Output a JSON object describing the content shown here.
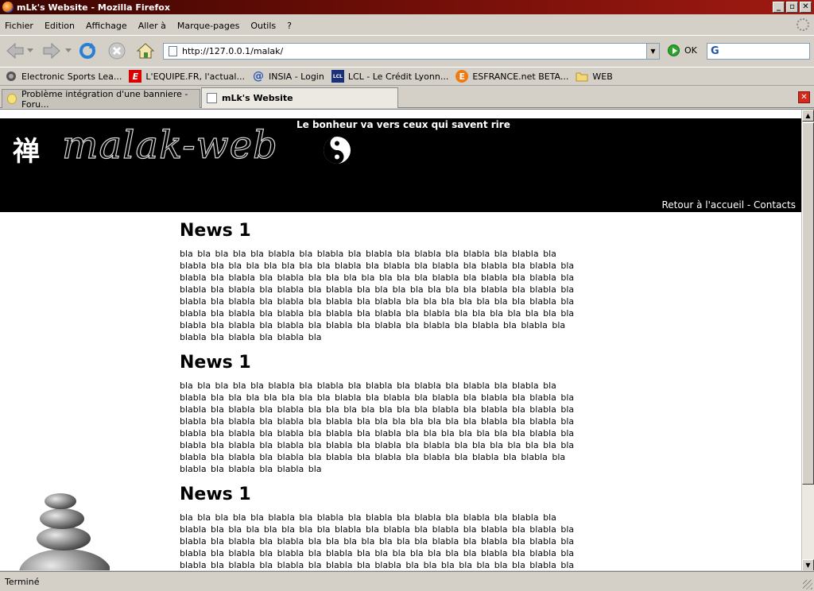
{
  "window": {
    "title": "mLk's Website - Mozilla Firefox"
  },
  "menu": {
    "items": [
      "Fichier",
      "Edition",
      "Affichage",
      "Aller à",
      "Marque-pages",
      "Outils",
      "?"
    ]
  },
  "nav": {
    "url": "http://127.0.0.1/malak/",
    "go_label": "OK"
  },
  "bookmarks": [
    {
      "label": "Electronic Sports Lea...",
      "icon": "esl-icon"
    },
    {
      "label": "L'EQUIPE.FR, l'actual...",
      "icon": "lequipe-icon"
    },
    {
      "label": "INSIA - Login",
      "icon": "at-icon"
    },
    {
      "label": "LCL - Le Crédit Lyonn...",
      "icon": "lcl-icon"
    },
    {
      "label": "ESFRANCE.net BETA...",
      "icon": "esfrance-icon"
    },
    {
      "label": "WEB",
      "icon": "folder-icon"
    }
  ],
  "tabs": [
    {
      "label": "Problème intégration d'une banniere - Foru...",
      "active": false
    },
    {
      "label": "mLk's Website",
      "active": true
    }
  ],
  "page": {
    "banner": {
      "kanji": "禅",
      "logo": "malak-web",
      "tagline": "Le bonheur va vers ceux qui savent rire",
      "links": "Retour à l'accueil - Contacts"
    },
    "news": [
      {
        "title": "News 1",
        "body": "bla bla bla bla bla blabla bla blabla bla blabla bla blabla bla blabla bla blabla bla blabla bla bla bla bla bla bla bla blabla bla blabla bla blabla bla blabla bla blabla bla blabla bla blabla bla blabla bla bla bla bla bla bla bla blabla bla blabla bla blabla bla blabla bla blabla bla blabla bla blabla bla bla bla bla bla bla bla blabla bla blabla bla blabla bla blabla bla blabla bla blabla bla blabla bla bla bla bla bla bla bla blabla bla blabla bla blabla bla blabla bla blabla bla blabla bla blabla bla bla bla bla bla bla bla blabla bla blabla bla blabla bla blabla bla blabla bla blabla bla blabla bla blabla bla blabla bla blabla bla blabla bla"
      },
      {
        "title": "News 1",
        "body": "bla bla bla bla bla blabla bla blabla bla blabla bla blabla bla blabla bla blabla bla blabla bla bla bla bla bla bla bla blabla bla blabla bla blabla bla blabla bla blabla bla blabla bla blabla bla blabla bla bla bla bla bla bla bla blabla bla blabla bla blabla bla blabla bla blabla bla blabla bla blabla bla bla bla bla bla bla bla blabla bla blabla bla blabla bla blabla bla blabla bla blabla bla blabla bla bla bla bla bla bla bla blabla bla blabla bla blabla bla blabla bla blabla bla blabla bla blabla bla bla bla bla bla bla bla blabla bla blabla bla blabla bla blabla bla blabla bla blabla bla blabla bla blabla bla blabla bla blabla bla blabla bla"
      },
      {
        "title": "News 1",
        "body": "bla bla bla bla bla blabla bla blabla bla blabla bla blabla bla blabla bla blabla bla blabla bla bla bla bla bla bla bla blabla bla blabla bla blabla bla blabla bla blabla bla blabla bla blabla bla blabla bla bla bla bla bla bla bla blabla bla blabla bla blabla bla blabla bla blabla bla blabla bla blabla bla bla bla bla bla bla bla blabla bla blabla bla blabla bla blabla bla blabla bla blabla bla blabla bla bla bla bla bla bla bla blabla bla blabla bla blabla bla blabla bla blabla bla blabla bla blabla bla bla bla bla bla bla bla blabla bla blabla bla blabla bla blabla bla blabla bla blabla bla blabla bla blabla bla blabla bla blabla bla blabla bla"
      }
    ]
  },
  "status": {
    "text": "Terminé"
  },
  "colors": {
    "titlebar": "#6b0d07",
    "banner_bg": "#000000",
    "close_tab": "#d8281c"
  }
}
